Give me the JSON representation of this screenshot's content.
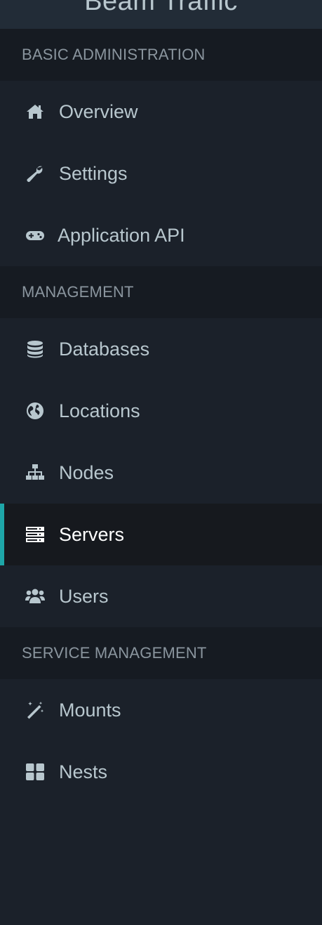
{
  "brand": {
    "title": "Beam Traffic"
  },
  "sections": [
    {
      "header": "BASIC ADMINISTRATION",
      "items": [
        {
          "label": "Overview",
          "icon": "home-icon"
        },
        {
          "label": "Settings",
          "icon": "wrench-icon"
        },
        {
          "label": "Application API",
          "icon": "gamepad-icon"
        }
      ]
    },
    {
      "header": "MANAGEMENT",
      "items": [
        {
          "label": "Databases",
          "icon": "database-icon"
        },
        {
          "label": "Locations",
          "icon": "globe-icon"
        },
        {
          "label": "Nodes",
          "icon": "sitemap-icon"
        },
        {
          "label": "Servers",
          "icon": "server-icon",
          "active": true
        },
        {
          "label": "Users",
          "icon": "users-icon"
        }
      ]
    },
    {
      "header": "SERVICE MANAGEMENT",
      "items": [
        {
          "label": "Mounts",
          "icon": "magic-wand-icon"
        },
        {
          "label": "Nests",
          "icon": "grid-icon"
        }
      ]
    }
  ],
  "colors": {
    "accent": "#1ea6a8",
    "text": "#b8c7ce",
    "active_text": "#ffffff",
    "header_text": "#8a959e"
  }
}
